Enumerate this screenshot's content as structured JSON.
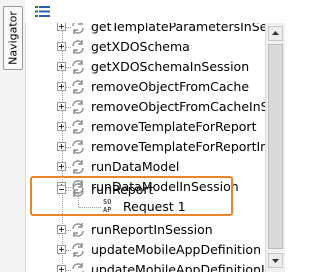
{
  "navigator": {
    "tab_label": "Navigator"
  },
  "toolbar": {
    "view_icon": "tree-view-icon"
  },
  "tree": {
    "items": [
      {
        "label": "getTemplateParametersInSession",
        "icon": "operation-refresh-icon"
      },
      {
        "label": "getXDOSchema",
        "icon": "operation-refresh-icon"
      },
      {
        "label": "getXDOSchemaInSession",
        "icon": "operation-refresh-icon"
      },
      {
        "label": "removeObjectFromCache",
        "icon": "operation-refresh-icon"
      },
      {
        "label": "removeObjectFromCacheInSession",
        "icon": "operation-refresh-icon"
      },
      {
        "label": "removeTemplateForReport",
        "icon": "operation-refresh-icon"
      },
      {
        "label": "removeTemplateForReportInSession",
        "icon": "operation-refresh-icon"
      },
      {
        "label": "runDataModel",
        "icon": "operation-refresh-icon"
      },
      {
        "label": "runDataModelInSession",
        "icon": "operation-refresh-icon"
      },
      {
        "label": "runReport",
        "icon": "operation-refresh-icon",
        "expanded": true,
        "children": [
          {
            "label": "Request 1",
            "icon": "soap-request-icon",
            "icon_text": [
              "SO",
              "AP"
            ]
          }
        ]
      },
      {
        "label": "runReportInSession",
        "icon": "operation-refresh-icon"
      },
      {
        "label": "updateMobileAppDefinition",
        "icon": "operation-refresh-icon"
      },
      {
        "label": "updateMobileAppDefinitionInSession",
        "icon": "operation-refresh-icon"
      }
    ]
  },
  "colors": {
    "highlight": "#e9842b",
    "icon_gray": "#8a8a8a",
    "toolbar_icon": "#2a7a3a"
  }
}
